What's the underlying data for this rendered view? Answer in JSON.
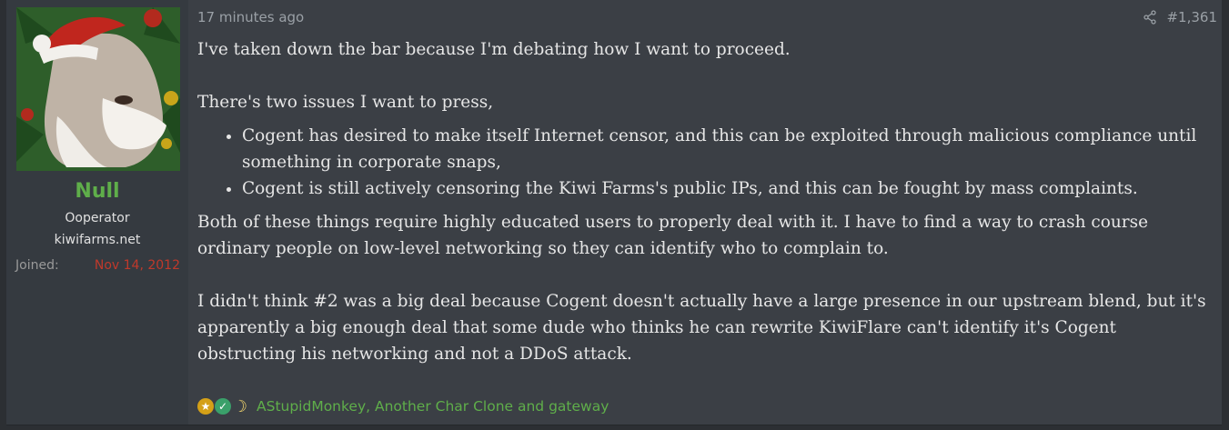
{
  "user": {
    "name": "Null",
    "title": "Ooperator",
    "site": "kiwifarms.net",
    "joined_label": "Joined:",
    "joined_value": "Nov 14, 2012",
    "avatar_icon": "santa-dog-avatar"
  },
  "post": {
    "time": "17 minutes ago",
    "number": "#1,361",
    "share_icon": "share-icon",
    "paragraphs": {
      "p1": "I've taken down the bar because I'm debating how I want to proceed.",
      "p2": "There's two issues I want to press,",
      "bullets": [
        "Cogent has desired to make itself Internet censor, and this can be exploited through malicious compliance until something in corporate snaps,",
        "Cogent is still actively censoring the Kiwi Farms's public IPs, and this can be fought by mass complaints."
      ],
      "p3": "Both of these things require highly educated users to properly deal with it. I have to find a way to crash course ordinary people on low-level networking so they can identify who to complain to.",
      "p4": "I didn't think #2 was a big deal because Cogent doesn't actually have a large presence in our upstream blend, but it's apparently a big enough deal that some dude who thinks he can rewrite KiwiFlare can't identify it's Cogent obstructing his networking and not a DDoS attack."
    },
    "reactions": {
      "icons": [
        "medal-icon",
        "check-icon",
        "moon-icon"
      ],
      "users_text": "AStupidMonkey, Another Char Clone and gateway"
    }
  },
  "colors": {
    "username": "#5fae4a",
    "joined_date": "#c0392b",
    "reactions_link": "#5fae4a"
  }
}
